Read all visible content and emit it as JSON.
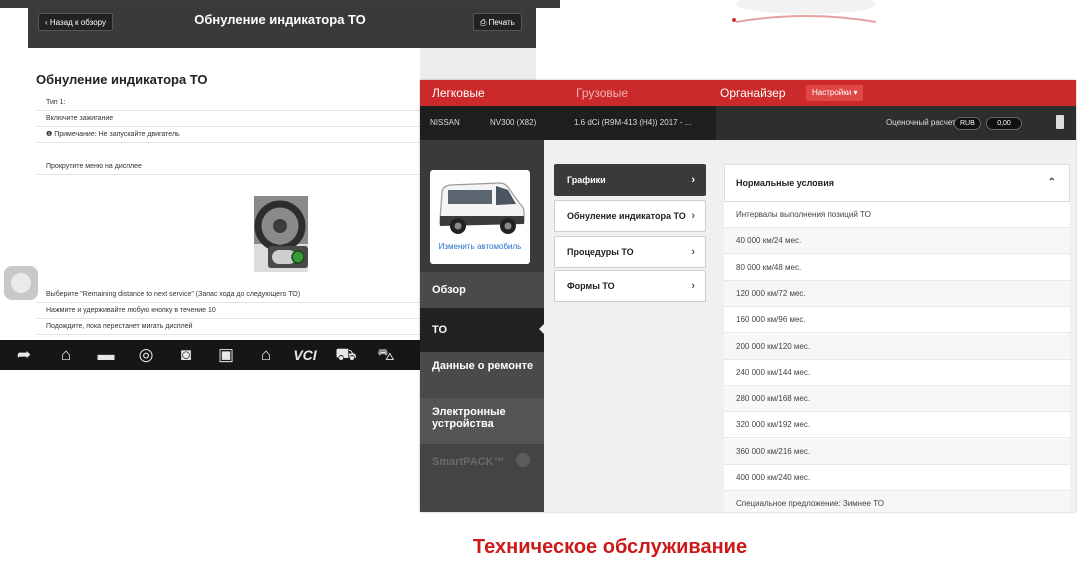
{
  "left": {
    "back_label": "‹  Назад к обзору",
    "toolbar_title": "Обнуление индикатора ТО",
    "print_label": "⎙  Печать",
    "heading": "Обнуление индикатора ТО",
    "rows_top": [
      "Тип 1:",
      "Включите зажигание",
      "❶  Примечание: Не запускайте двигатель",
      "Прокрутите меню на дисплее"
    ],
    "rows_bottom": [
      "Выберите \"Remaining distance to next service\" (Запас хода до следующего ТО)",
      "Нажмите и удерживайте любую кнопку в течение 10",
      "Подождите, пока перестанет мигать дисплей"
    ],
    "nav_icons": [
      "back-icon",
      "home-icon",
      "recent-apps-icon",
      "browser-icon",
      "camera-icon",
      "screen-icon",
      "garage-icon",
      "vci-icon",
      "car-diagnostics-icon",
      "user-car-icon"
    ],
    "vci_label": "VCI"
  },
  "right": {
    "tabs": {
      "cars": "Легковые",
      "trucks": "Грузовые",
      "organizer": "Органайзер"
    },
    "settings_label": "Настройки  ▾",
    "vehicle": {
      "make": "NISSAN",
      "model": "NV300 (X82)",
      "engine": "1.6 dCi (R9M-413 (H4)) 2017 - ..."
    },
    "estimate_label": "Оценочный расчет",
    "currency": "RUB",
    "amount": "0,00",
    "change_car": "Изменить автомобиль",
    "sidebar": {
      "overview": "Обзор",
      "to": "ТО",
      "repair": "Данные о ремонте",
      "electronics": "Электронные устройства",
      "smartpack": "SmartPACK™"
    },
    "menu": [
      "Графики",
      "Обнуление индикатора ТО",
      "Процедуры ТО",
      "Формы ТО"
    ],
    "panel_title": "Нормальные условия",
    "panel_rows": [
      "Интервалы выполнения позиций ТО",
      "40 000 км/24 мес.",
      "80 000 км/48 мес.",
      "120 000 км/72 мес.",
      "160 000 км/96 мес.",
      "200 000 км/120 мес.",
      "240 000 км/144 мес.",
      "280 000 км/168 мес.",
      "320 000 км/192 мес.",
      "360 000 км/216 мес.",
      "400 000 км/240 мес.",
      "Специальное предложение: Зимнее ТО"
    ]
  },
  "caption": "Техническое обслуживание",
  "colors": {
    "brand_red": "#cc2a2a",
    "caption_red": "#cc1a1a",
    "link_blue": "#2070c8"
  }
}
